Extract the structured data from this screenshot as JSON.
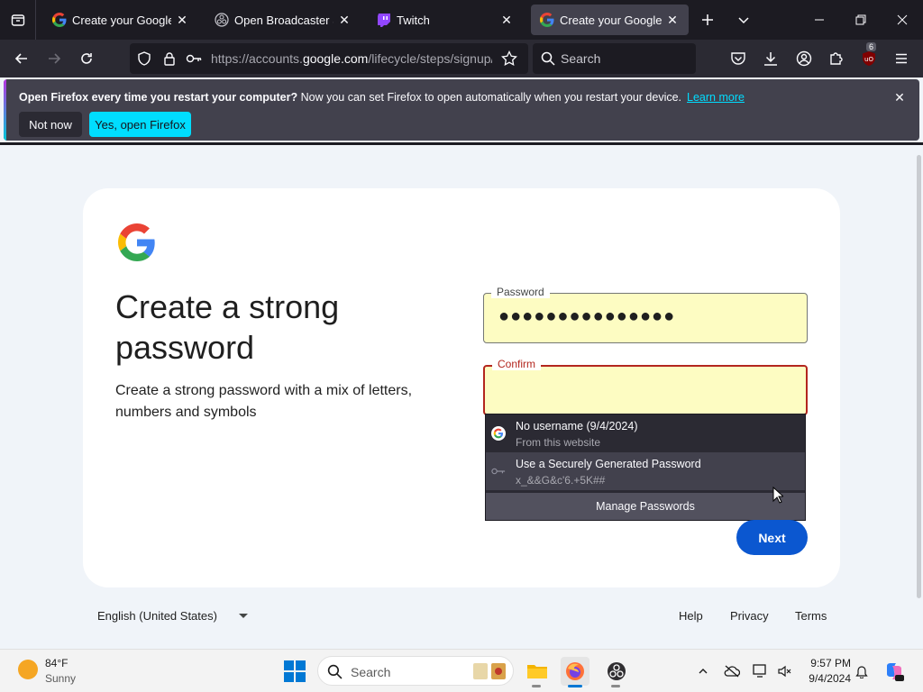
{
  "browser": {
    "tabs": [
      {
        "title": "Create your Google Account",
        "favicon": "google-g-icon",
        "active": false
      },
      {
        "title": "Open Broadcaster Software",
        "favicon": "obs-icon",
        "active": false
      },
      {
        "title": "Twitch",
        "favicon": "twitch-icon",
        "active": false
      },
      {
        "title": "Create your Google Account",
        "favicon": "google-g-icon",
        "active": true
      }
    ],
    "url_prefix": "https://accounts.",
    "url_domain": "google.com",
    "url_suffix": "/lifecycle/steps/signup/password",
    "search_placeholder": "Search",
    "extension_badge": "6"
  },
  "notification": {
    "strong_text": "Open Firefox every time you restart your computer?",
    "text": " Now you can set Firefox to open automatically when you restart your device.",
    "learn_more": "Learn more",
    "not_now_label": "Not now",
    "yes_label": "Yes, open Firefox"
  },
  "page": {
    "title": "Create a strong password",
    "subtitle": "Create a strong password with a mix of letters, numbers and symbols",
    "password_label": "Password",
    "password_value": "●●●●●●●●●●●●●●●",
    "confirm_label": "Confirm",
    "confirm_value": "",
    "next_label": "Next",
    "language": "English (United States)",
    "footer_help": "Help",
    "footer_privacy": "Privacy",
    "footer_terms": "Terms"
  },
  "autocomplete": {
    "item1_main": "No username (9/4/2024)",
    "item1_sub": "From this website",
    "item2_main": "Use a Securely Generated Password",
    "item2_sub": "x_&&G&c'6.+5K##",
    "manage_label": "Manage Passwords"
  },
  "taskbar": {
    "weather_temp": "84°F",
    "weather_cond": "Sunny",
    "search_placeholder": "Search",
    "time": "9:57 PM",
    "date": "9/4/2024"
  },
  "colors": {
    "accent_blue": "#0b57d0",
    "error_red": "#b3261e",
    "autofill_yellow": "#fdfcc2",
    "firefox_cyan": "#00ddff"
  }
}
